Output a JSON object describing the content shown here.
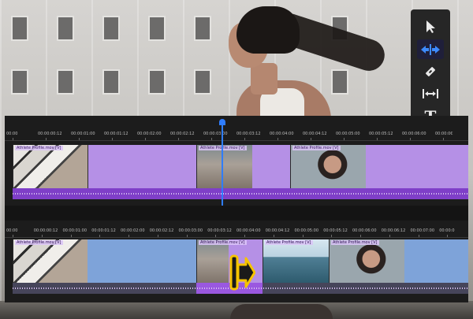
{
  "toolbar": {
    "tools": [
      {
        "name": "selection-tool",
        "icon": "arrow-pointer-icon",
        "active": false
      },
      {
        "name": "ripple-edit-tool",
        "icon": "ripple-edit-icon",
        "active": true
      },
      {
        "name": "razor-tool",
        "icon": "razor-icon",
        "active": false
      },
      {
        "name": "slip-tool",
        "icon": "slip-icon",
        "active": false
      },
      {
        "name": "type-tool",
        "icon": "type-icon",
        "active": false
      }
    ],
    "type_glyph": "T",
    "accent": "#3d8bff"
  },
  "timeline_top": {
    "ruler": [
      "00:00",
      "00:00:00:12",
      "00:00:01:00",
      "00:00:01:12",
      "00:00:02:00",
      "00:00:02:12",
      "00:00:03:00",
      "00:00:03:12",
      "00:00:04:00",
      "00:00:04:12",
      "00:00:05:00",
      "00:00:05:12",
      "00:00:06:00",
      "00:00:0€"
    ],
    "clips": [
      {
        "label": "Athlete Profile.mov [V]"
      },
      {
        "label": "Athlete Profile.mov [V]"
      },
      {
        "label": "Athlete Profile.mov [V]"
      }
    ],
    "track_color": "#b590e6"
  },
  "timeline_bottom": {
    "ruler": [
      "00:00",
      "00:00:00:12",
      "00:00:01:00",
      "00:00:01:12",
      "00:00:02:00",
      "00:00:02:12",
      "00:00:03:00",
      "00:00:03:12",
      "00:00:04:00",
      "00:00:04:12",
      "00:00:05:00",
      "00:00:05:12",
      "00:00:06:00",
      "00:00:06:12",
      "00:00:07:00",
      "00:00:0"
    ],
    "clips": [
      {
        "label": "Athlete Profile.mov [V]"
      },
      {
        "label": "Athlete Profile.mov [V]"
      },
      {
        "label": "Athlete Profile.mov [V]"
      },
      {
        "label": "Athlete Profile.mov [V]"
      }
    ],
    "track_color": "#7ea3d9"
  }
}
